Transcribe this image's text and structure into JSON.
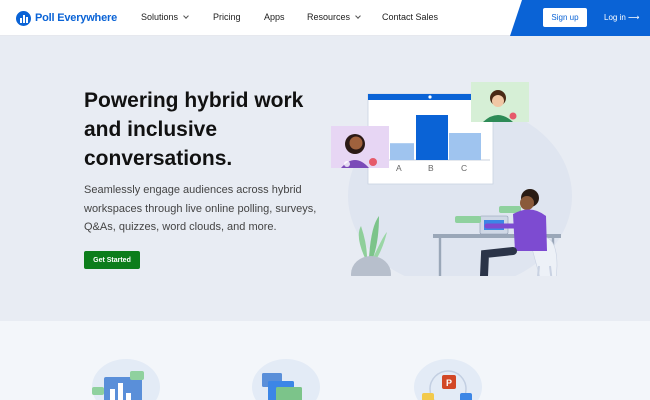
{
  "nav": {
    "brand": "Poll Everywhere",
    "items": [
      {
        "label": "Solutions",
        "has_dropdown": true
      },
      {
        "label": "Pricing",
        "has_dropdown": false
      },
      {
        "label": "Apps",
        "has_dropdown": false
      },
      {
        "label": "Resources",
        "has_dropdown": true
      },
      {
        "label": "Contact Sales",
        "has_dropdown": false
      }
    ],
    "signup_label": "Sign up",
    "login_label": "Log in ⟶"
  },
  "hero": {
    "title": "Powering hybrid work and inclusive conversations.",
    "subtitle": "Seamlessly engage audiences across hybrid workspaces through live online polling, surveys, Q&As, quizzes, word clouds, and more.",
    "cta_label": "Get Started",
    "illustration": {
      "chart_labels": [
        "A",
        "B",
        "C"
      ],
      "bar_levels": [
        0.28,
        0.75,
        0.45
      ]
    }
  },
  "colors": {
    "brand_blue": "#0a63d6",
    "cta_green": "#0c7d1b",
    "hero_bg": "#e8ecf3",
    "features_bg": "#f3f6fa"
  },
  "features": {
    "icons": [
      "poll-chart-icon",
      "folders-icon",
      "integrations-icon"
    ]
  }
}
